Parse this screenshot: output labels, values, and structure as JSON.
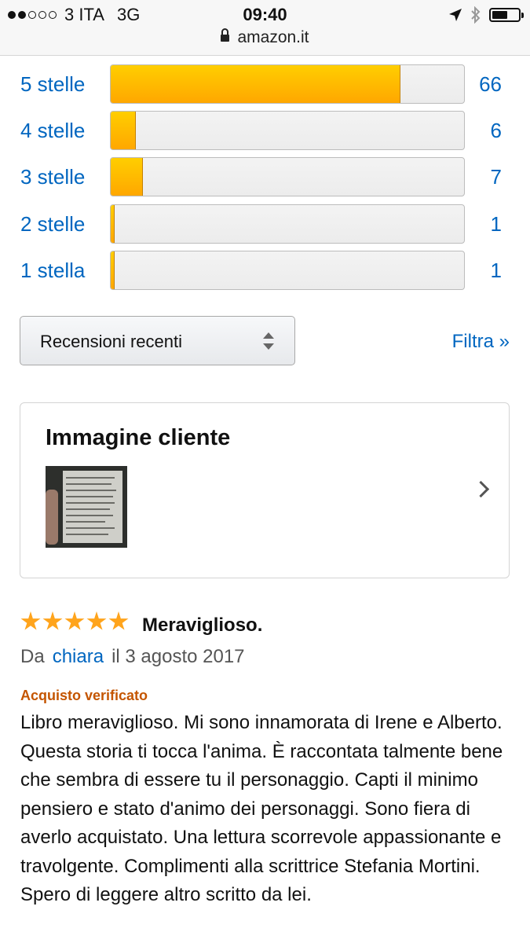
{
  "status_bar": {
    "carrier": "3 ITA",
    "network": "3G",
    "time": "09:40",
    "url": "amazon.it",
    "battery_level": 0.6
  },
  "histogram": [
    {
      "label": "5 stelle",
      "count": "66",
      "fraction": 0.82
    },
    {
      "label": "4 stelle",
      "count": "6",
      "fraction": 0.07
    },
    {
      "label": "3 stelle",
      "count": "7",
      "fraction": 0.09
    },
    {
      "label": "2 stelle",
      "count": "1",
      "fraction": 0.01
    },
    {
      "label": "1 stella",
      "count": "1",
      "fraction": 0.01
    }
  ],
  "sort": {
    "label": "Recensioni recenti"
  },
  "filter_label": "Filtra »",
  "customer_images": {
    "title": "Immagine cliente"
  },
  "review": {
    "stars": 5,
    "title": "Meraviglioso.",
    "by_prefix": "Da",
    "author": "chiara",
    "date": "il 3 agosto 2017",
    "verified": "Acquisto verificato",
    "body": "Libro meraviglioso. Mi sono innamorata di Irene e Alberto. Questa storia ti tocca l'anima. È raccontata talmente bene che sembra di essere tu il personaggio. Capti il minimo pensiero e stato d'animo dei personaggi. Sono fiera di averlo acquistato. Una lettura scorrevole appassionante e travolgente. Complimenti alla scrittrice Stefania Mortini. Spero di leggere altro scritto da lei."
  },
  "colors": {
    "link": "#0066c0",
    "bar_fill": "#ffa700",
    "verified": "#c45500",
    "star": "#ffa41c"
  }
}
